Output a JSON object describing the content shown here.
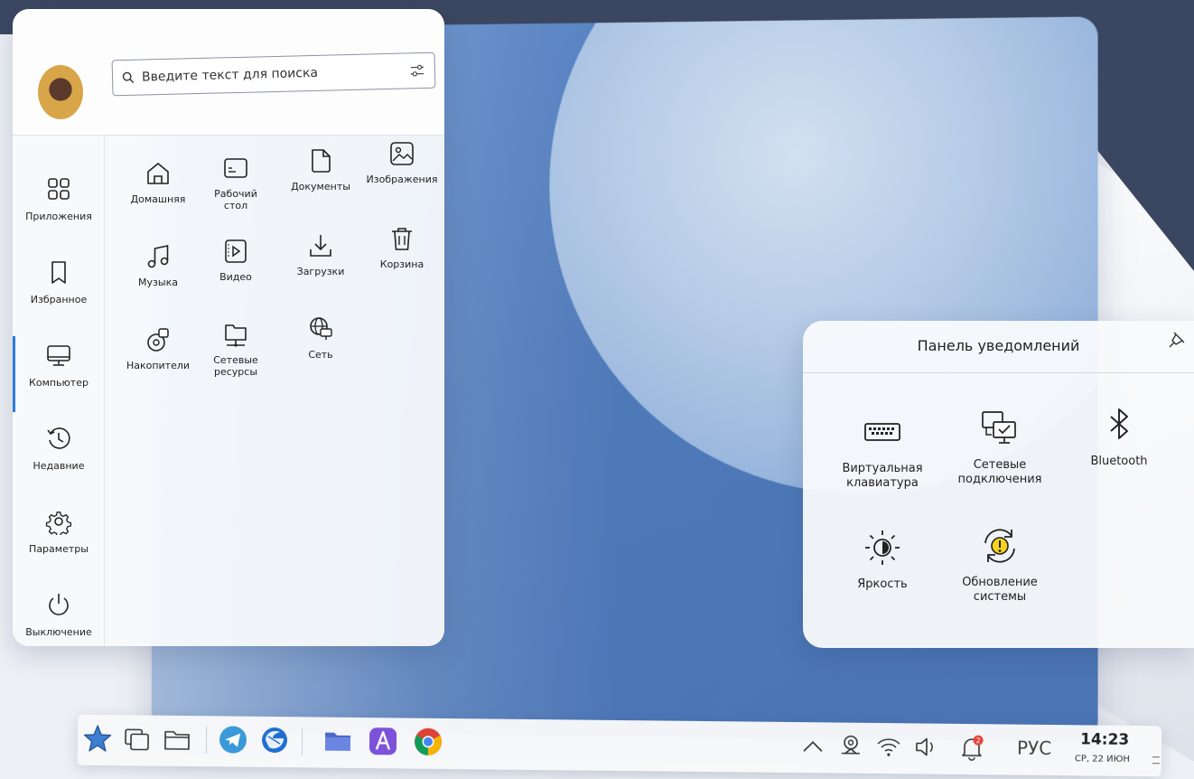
{
  "colors": {
    "accent": "#2f7bd6",
    "header_band": "#3b4660",
    "desktop": "#5a86c6"
  },
  "start_menu": {
    "search": {
      "placeholder": "Введите текст для поиска",
      "icon": "search-icon",
      "filter_icon": "filter-icon"
    },
    "sidebar": [
      {
        "label": "Приложения",
        "icon": "apps-grid-icon"
      },
      {
        "label": "Избранное",
        "icon": "bookmark-icon"
      },
      {
        "label": "Компьютер",
        "icon": "monitor-icon",
        "active": true
      },
      {
        "label": "Недавние",
        "icon": "history-icon"
      },
      {
        "label": "Параметры",
        "icon": "gear-icon"
      },
      {
        "label": "Выключение",
        "icon": "power-icon"
      }
    ],
    "places": [
      {
        "label": "Домашняя",
        "icon": "home-icon"
      },
      {
        "label": "Рабочий стол",
        "icon": "desktop-icon"
      },
      {
        "label": "Документы",
        "icon": "document-icon"
      },
      {
        "label": "Изображения",
        "icon": "image-icon"
      },
      {
        "label": "Музыка",
        "icon": "music-icon"
      },
      {
        "label": "Видео",
        "icon": "video-icon"
      },
      {
        "label": "Загрузки",
        "icon": "download-icon"
      },
      {
        "label": "Корзина",
        "icon": "trash-icon"
      },
      {
        "label": "Накопители",
        "icon": "drives-icon"
      },
      {
        "label": "Сетевые ресурсы",
        "icon": "network-folder-icon"
      },
      {
        "label": "Сеть",
        "icon": "network-globe-icon"
      }
    ]
  },
  "notification_panel": {
    "title": "Панель уведомлений",
    "items": [
      {
        "label": "Виртуальная клавиатура",
        "icon": "keyboard-icon"
      },
      {
        "label": "Сетевые подключения",
        "icon": "network-connections-icon"
      },
      {
        "label": "Bluetooth",
        "icon": "bluetooth-icon"
      },
      {
        "label": "Яркость",
        "icon": "brightness-icon"
      },
      {
        "label": "Обновление системы",
        "icon": "system-update-icon"
      }
    ]
  },
  "taskbar": {
    "apps": [
      {
        "name": "start-star-icon"
      },
      {
        "name": "windows-icon"
      },
      {
        "name": "folder-icon"
      },
      {
        "name": "telegram-icon"
      },
      {
        "name": "thunderbird-icon"
      },
      {
        "name": "files-icon"
      },
      {
        "name": "app-store-icon"
      },
      {
        "name": "chrome-icon"
      }
    ],
    "tray": {
      "notification_count": "2",
      "language": "РУС",
      "time": "14:23",
      "date": "СР, 22 ИЮН"
    }
  }
}
